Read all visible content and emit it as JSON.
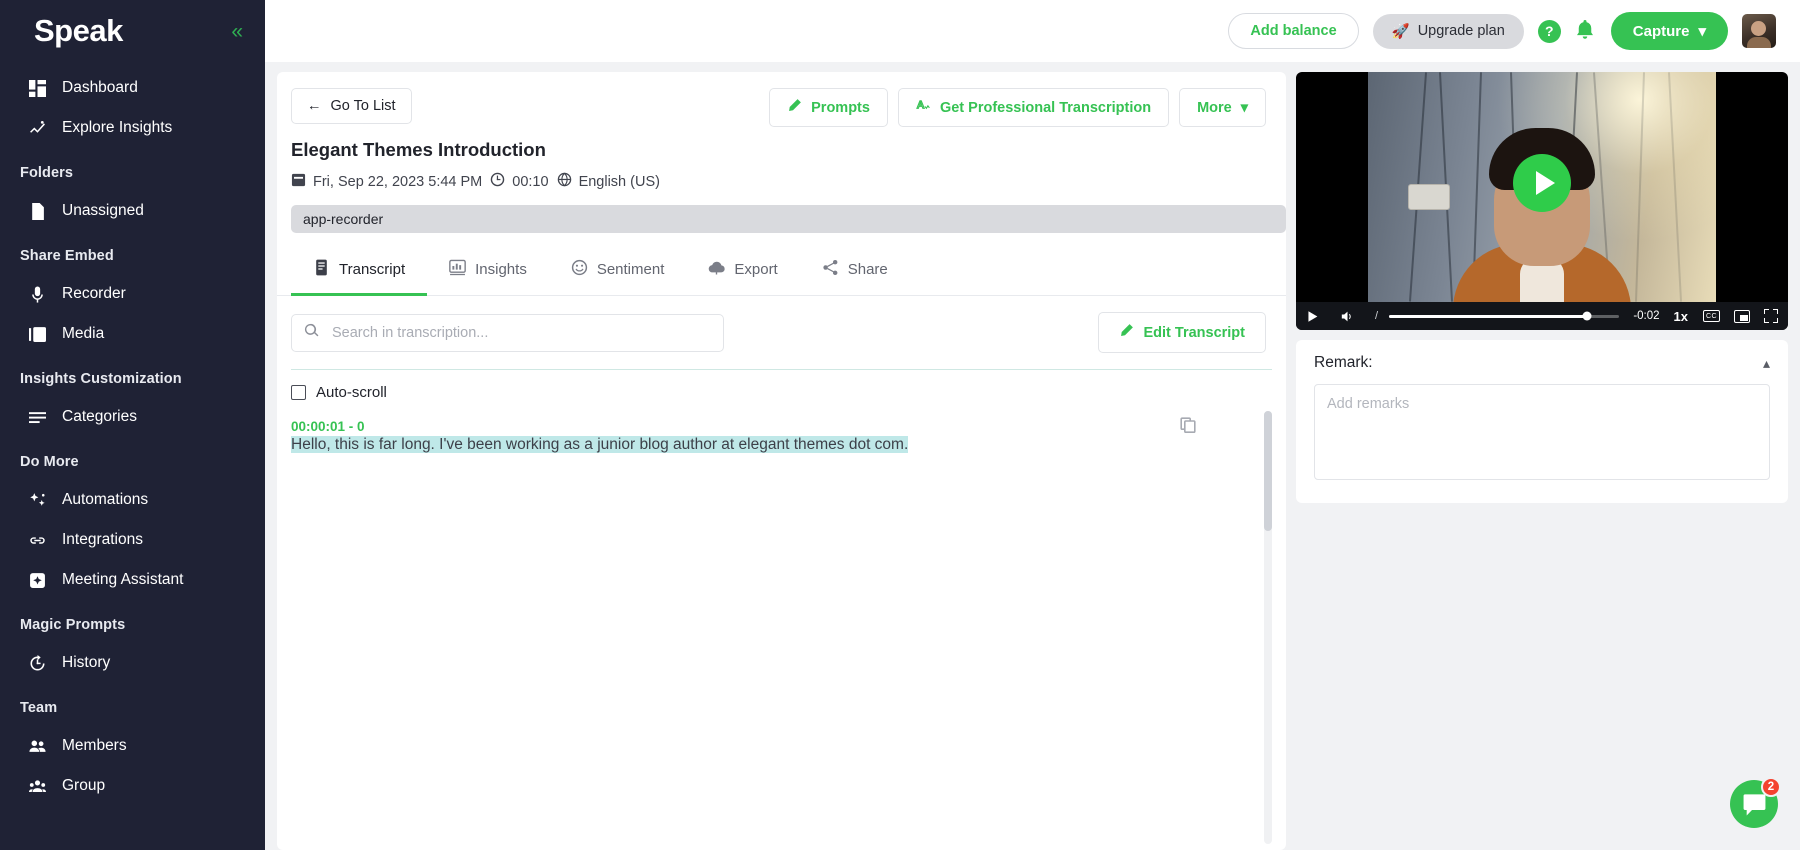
{
  "brand": {
    "name": "Speak",
    "collapse_icon": "chevrons-left-icon"
  },
  "sidebar": {
    "groups": [
      {
        "label": null,
        "items": [
          {
            "label": "Dashboard",
            "icon": "dashboard-icon"
          },
          {
            "label": "Explore Insights",
            "icon": "explore-insights-icon"
          }
        ]
      },
      {
        "label": "Folders",
        "items": [
          {
            "label": "Unassigned",
            "icon": "file-icon"
          }
        ]
      },
      {
        "label": "Share Embed",
        "items": [
          {
            "label": "Recorder",
            "icon": "microphone-icon"
          },
          {
            "label": "Media",
            "icon": "media-icon"
          }
        ]
      },
      {
        "label": "Insights Customization",
        "items": [
          {
            "label": "Categories",
            "icon": "list-icon"
          }
        ]
      },
      {
        "label": "Do More",
        "items": [
          {
            "label": "Automations",
            "icon": "sparkles-icon"
          },
          {
            "label": "Integrations",
            "icon": "link-icon"
          },
          {
            "label": "Meeting Assistant",
            "icon": "meeting-assistant-icon"
          }
        ]
      },
      {
        "label": "Magic Prompts",
        "items": [
          {
            "label": "History",
            "icon": "history-icon"
          }
        ]
      },
      {
        "label": "Team",
        "items": [
          {
            "label": "Members",
            "icon": "members-icon"
          },
          {
            "label": "Group",
            "icon": "group-icon"
          }
        ]
      }
    ]
  },
  "topbar": {
    "add_balance": "Add balance",
    "upgrade_plan": "Upgrade plan",
    "upgrade_icon": "rocket-icon",
    "help": "?",
    "bell_icon": "bell-icon",
    "capture": "Capture",
    "capture_chevron": "chevron-down-icon",
    "avatar": "user-avatar"
  },
  "toolbar": {
    "go_to_list": "Go To List",
    "back_icon": "arrow-left-icon",
    "prompts": "Prompts",
    "prompts_icon": "pencil-sparkle-icon",
    "get_transcription": "Get Professional Transcription",
    "transcription_icon": "waveform-a-icon",
    "more": "More",
    "more_chevron": "chevron-down-icon"
  },
  "document": {
    "title": "Elegant Themes Introduction",
    "date": "Fri, Sep 22, 2023 5:44 PM",
    "duration": "00:10",
    "language": "English (US)",
    "tag": "app-recorder",
    "date_icon": "calendar-icon",
    "duration_icon": "clock-icon",
    "language_icon": "globe-icon"
  },
  "tabs": [
    {
      "label": "Transcript",
      "icon": "transcript-icon",
      "active": true
    },
    {
      "label": "Insights",
      "icon": "insights-icon",
      "active": false
    },
    {
      "label": "Sentiment",
      "icon": "sentiment-icon",
      "active": false
    },
    {
      "label": "Export",
      "icon": "export-icon",
      "active": false
    },
    {
      "label": "Share",
      "icon": "share-icon",
      "active": false
    }
  ],
  "search": {
    "placeholder": "Search in transcription...",
    "value": "",
    "icon": "search-icon"
  },
  "edit_transcript": {
    "label": "Edit Transcript",
    "icon": "pencil-icon"
  },
  "autoscroll": {
    "label": "Auto-scroll",
    "checked": false
  },
  "transcript": {
    "segments": [
      {
        "time": "00:00:01 - 0",
        "text": "Hello, this is far long. I've been working as a junior blog author at elegant themes dot com.",
        "copy_icon": "copy-icon",
        "highlighted": true
      }
    ]
  },
  "player": {
    "play_icon": "play-icon",
    "volume_icon": "volume-icon",
    "time_separator": "/",
    "remaining": "-0:02",
    "speed": "1x",
    "cc": "CC",
    "pip_icon": "picture-in-picture-icon",
    "fullscreen_icon": "fullscreen-icon",
    "progress_percent": 86,
    "overlay_play_icon": "play-circle-icon"
  },
  "remark": {
    "title": "Remark:",
    "placeholder": "Add remarks",
    "value": "",
    "collapse_icon": "chevron-up-icon"
  },
  "chat": {
    "icon": "chat-bubble-icon",
    "badge": "2"
  },
  "colors": {
    "accent_green": "#36c253",
    "sidebar_bg": "#1f2235",
    "highlight": "#bfe8e8",
    "badge_red": "#f4422f"
  }
}
